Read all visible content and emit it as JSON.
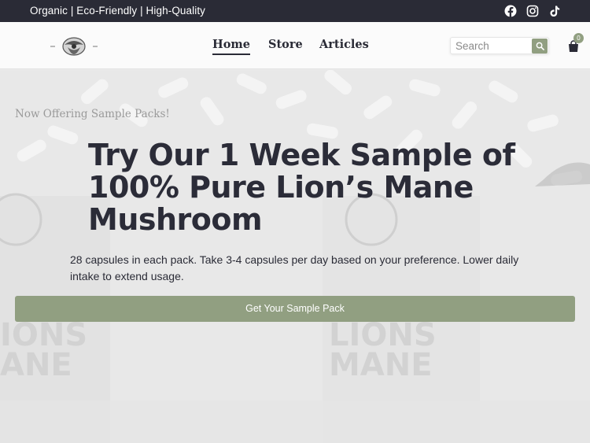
{
  "topbar": {
    "tagline": "Organic | Eco-Friendly | High-Quality",
    "social": [
      "facebook-icon",
      "instagram-icon",
      "tiktok-icon"
    ]
  },
  "header": {
    "nav": [
      {
        "label": "Home",
        "active": true
      },
      {
        "label": "Store",
        "active": false
      },
      {
        "label": "Articles",
        "active": false
      }
    ],
    "search": {
      "placeholder": "Search",
      "value": ""
    },
    "cart_count": "0"
  },
  "hero": {
    "eyebrow": "Now Offering Sample Packs!",
    "headline": "Try Our 1 Week Sample of 100% Pure Lion’s Mane Mushroom",
    "subtext": "28 capsules in each pack. Take 3-4 capsules per day based on your preference. Lower daily intake to extend usage.",
    "cta": "Get Your Sample Pack"
  },
  "colors": {
    "topbar": "#2a2b36",
    "accent": "#919f81",
    "text": "#2a2b36"
  }
}
